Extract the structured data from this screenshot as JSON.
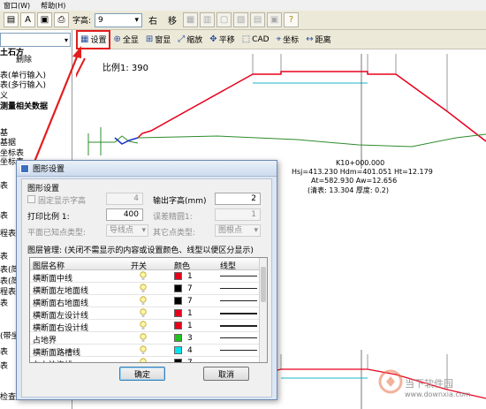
{
  "menu": {
    "items": [
      "窗口(W)",
      "帮助(H)"
    ]
  },
  "toolbar1": {
    "font_height_label": "字高:",
    "font_height_value": "9",
    "right_label": "右",
    "move_label": "移"
  },
  "left_panel": {
    "delete_label": "删除",
    "lines": [
      "土石方",
      "表(单行输入)",
      "表(多行输入)",
      "义",
      "测量相关数据",
      "基",
      "基据",
      "坐标表",
      "坐标表",
      "表",
      "表",
      "程表",
      "表",
      "表(简",
      "表(简",
      "程表",
      "表",
      "(带坐",
      "表",
      "表",
      "检查"
    ]
  },
  "toolbar2": {
    "buttons": [
      {
        "label": "设置",
        "icon": "settings-icon",
        "highlight": true
      },
      {
        "label": "全显",
        "icon": "zoom-all-icon"
      },
      {
        "label": "窗显",
        "icon": "zoom-window-icon"
      },
      {
        "label": "缩放",
        "icon": "zoom-icon"
      },
      {
        "label": "平移",
        "icon": "pan-icon"
      },
      {
        "label": "CAD",
        "icon": "cad-icon"
      },
      {
        "label": "坐标",
        "icon": "coordinate-icon"
      },
      {
        "label": "距离",
        "icon": "distance-icon"
      }
    ]
  },
  "canvas": {
    "scale_text": "比例1: 390",
    "section": {
      "station": "K10+000.000",
      "line1": "Hsj=413.230  Hdm=401.051  Ht=12.179",
      "line2": "At=582.930  Aw=12.656",
      "line3": "(清表: 13.304  厚度: 0.2)"
    }
  },
  "dialog": {
    "title": "图形设置",
    "group_label": "图形设置",
    "fixed_font_label": "固定显示字高",
    "fixed_font_value": "4",
    "output_font_label": "输出字高(mm)",
    "output_font_value": "2",
    "print_scale_label": "打印比例  1:",
    "print_scale_value": "400",
    "error_circle_label": "误差精圆1:",
    "error_circle_value": "1",
    "known_point_label": "平面已知点类型:",
    "known_point_value": "导线点",
    "other_point_label": "其它点类型:",
    "other_point_value": "图根点",
    "layer_note": "图层管理: (关闭不需显示的内容或设置颜色、线型以便区分显示)",
    "table": {
      "headers": [
        "图层名称",
        "开关",
        "颜色",
        "线型"
      ],
      "rows": [
        {
          "name": "横断面中线",
          "color": "#e8001c",
          "index": "1",
          "thick": false
        },
        {
          "name": "横断面左地面线",
          "color": "#000000",
          "index": "7",
          "thick": false
        },
        {
          "name": "横断面右地面线",
          "color": "#000000",
          "index": "7",
          "thick": false
        },
        {
          "name": "横断面左设计线",
          "color": "#e8001c",
          "index": "1",
          "thick": true
        },
        {
          "name": "横断面右设计线",
          "color": "#e8001c",
          "index": "1",
          "thick": true
        },
        {
          "name": "占地界",
          "color": "#1fc21f",
          "index": "3",
          "thick": false
        },
        {
          "name": "横断面路槽线",
          "color": "#00e5ee",
          "index": "4",
          "thick": false
        },
        {
          "name": "左右边沟线",
          "color": "#000000",
          "index": "7",
          "thick": false
        }
      ]
    },
    "ok_label": "确定",
    "cancel_label": "取消"
  },
  "watermark": {
    "text": "当下软件园",
    "url_text": "www.downxia.com"
  },
  "colors": {
    "annotation": "#e31d1d",
    "design_line": "#e8001c",
    "ground_line": "#2c8c2c",
    "road_line": "#1ab7c7"
  }
}
